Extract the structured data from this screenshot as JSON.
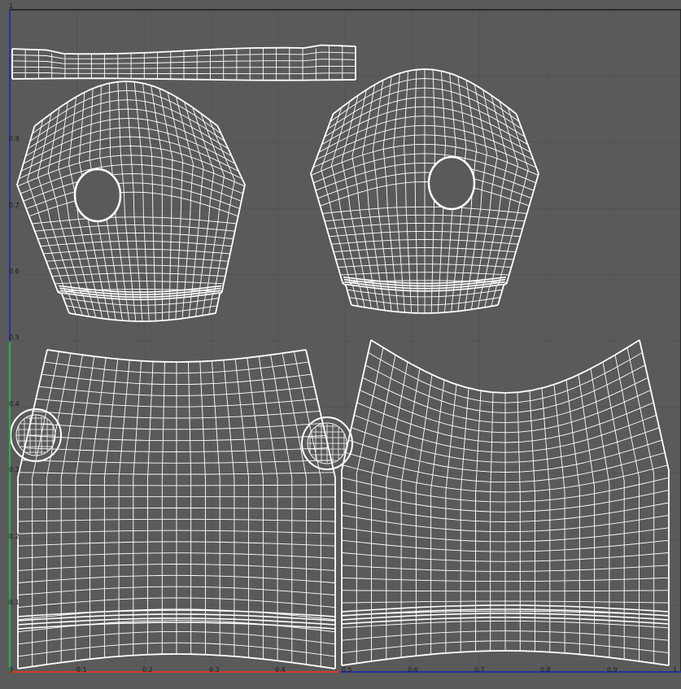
{
  "viewport": {
    "background": "#5a5a5a",
    "grid_color": "#535353",
    "frame_color": "#1a1a1a",
    "mesh_color": "#ffffff",
    "u_axis_color": "#d23a2a",
    "v_axis_color": "#21b54a",
    "origin_color": "#1f2cc4"
  },
  "axis_labels": {
    "origin": "0",
    "top": "1",
    "v": [
      "0.1",
      "0.2",
      "0.3",
      "0.4",
      "0.5",
      "0.6",
      "0.7",
      "0.8"
    ],
    "u": [
      "0.1",
      "0.2",
      "0.3",
      "0.4",
      "0.5",
      "0.6",
      "0.7",
      "0.8",
      "0.9",
      "1"
    ]
  },
  "uv_islands": [
    {
      "name": "collar-strip"
    },
    {
      "name": "left-sleeve"
    },
    {
      "name": "right-sleeve"
    },
    {
      "name": "back-panel"
    },
    {
      "name": "front-panel"
    },
    {
      "name": "left-button"
    },
    {
      "name": "right-button"
    }
  ]
}
